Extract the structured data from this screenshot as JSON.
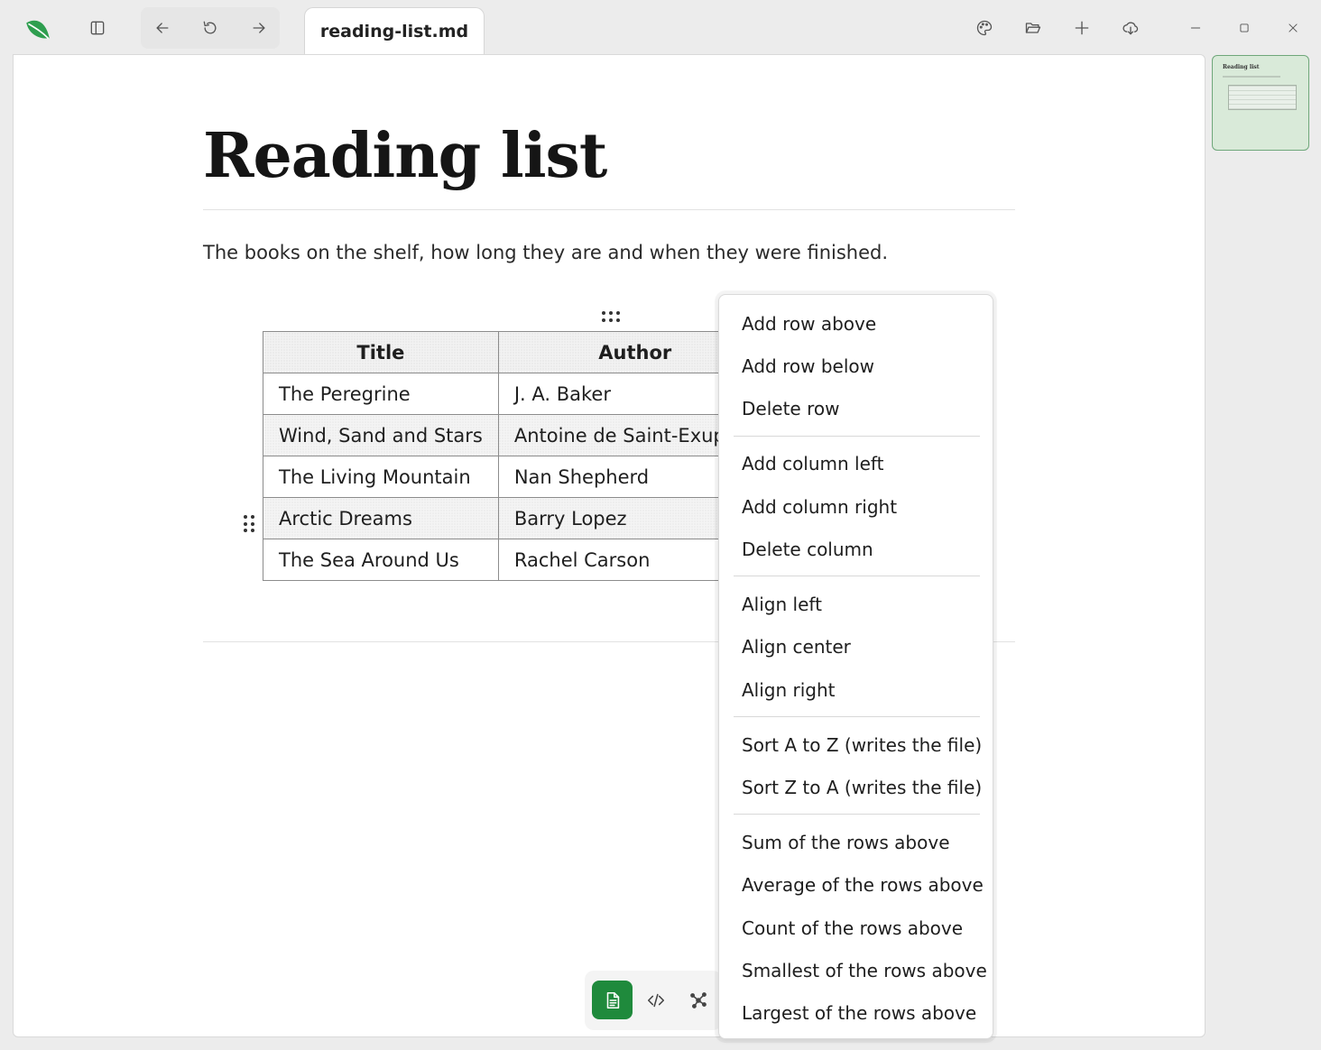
{
  "window": {
    "tab_title": "reading-list.md"
  },
  "titlebar": {
    "icons": [
      "app-leaf-icon",
      "sidebar-toggle-icon",
      "back-arrow-icon",
      "refresh-icon",
      "forward-arrow-icon",
      "palette-icon",
      "folder-open-icon",
      "plus-icon",
      "cloud-download-icon",
      "minimize-icon",
      "maximize-icon",
      "close-icon"
    ]
  },
  "colors": {
    "accent": "#1f8a3c",
    "leaf": "#2e9e4f"
  },
  "document": {
    "title": "Reading list",
    "intro": "The books on the shelf, how long they are and when they were finished."
  },
  "table": {
    "headers": [
      "Title",
      "Author"
    ],
    "rows": [
      [
        "The Peregrine",
        "J. A. Baker"
      ],
      [
        "Wind, Sand and Stars",
        "Antoine de Saint-Exupery"
      ],
      [
        "The Living Mountain",
        "Nan Shepherd"
      ],
      [
        "Arctic Dreams",
        "Barry Lopez"
      ],
      [
        "The Sea Around Us",
        "Rachel Carson"
      ]
    ]
  },
  "minimap": {
    "title": "Reading list"
  },
  "context_menu": {
    "groups": [
      [
        "Add row above",
        "Add row below",
        "Delete row"
      ],
      [
        "Add column left",
        "Add column right",
        "Delete column"
      ],
      [
        "Align left",
        "Align center",
        "Align right"
      ],
      [
        "Sort A to Z (writes the file)",
        "Sort Z to A (writes the file)"
      ],
      [
        "Sum of the rows above",
        "Average of the rows above",
        "Count of the rows above",
        "Smallest of the rows above",
        "Largest of the rows above"
      ]
    ]
  },
  "view_toolbar": {
    "buttons": [
      "document-view-icon",
      "source-code-icon",
      "graph-view-icon"
    ],
    "active": "document-view-icon"
  }
}
